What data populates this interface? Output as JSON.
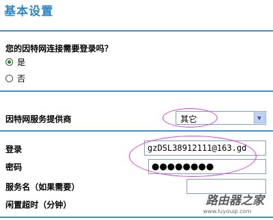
{
  "header": {
    "title": "基本设置"
  },
  "login_question": {
    "label": "您的因特网连接需要登录吗？",
    "options": [
      {
        "label": "是",
        "selected": true
      },
      {
        "label": "否",
        "selected": false
      }
    ]
  },
  "isp": {
    "label": "因特网服务提供商",
    "selected": "其它"
  },
  "fields": {
    "login_label": "登录",
    "login_value": "gzDSL38912111@163.gd",
    "password_label": "密码",
    "password_value": "●●●●●●●●",
    "service_label": "服务名（如果需要）",
    "service_value": "",
    "idle_label": "闲置超时（分钟）"
  },
  "watermark": {
    "text": "路由器之家",
    "sub": "www.luyouqi.com"
  },
  "colors": {
    "title": "#2f86c7",
    "rule": "#3b8fd0",
    "annotation": "#d93ad9"
  }
}
